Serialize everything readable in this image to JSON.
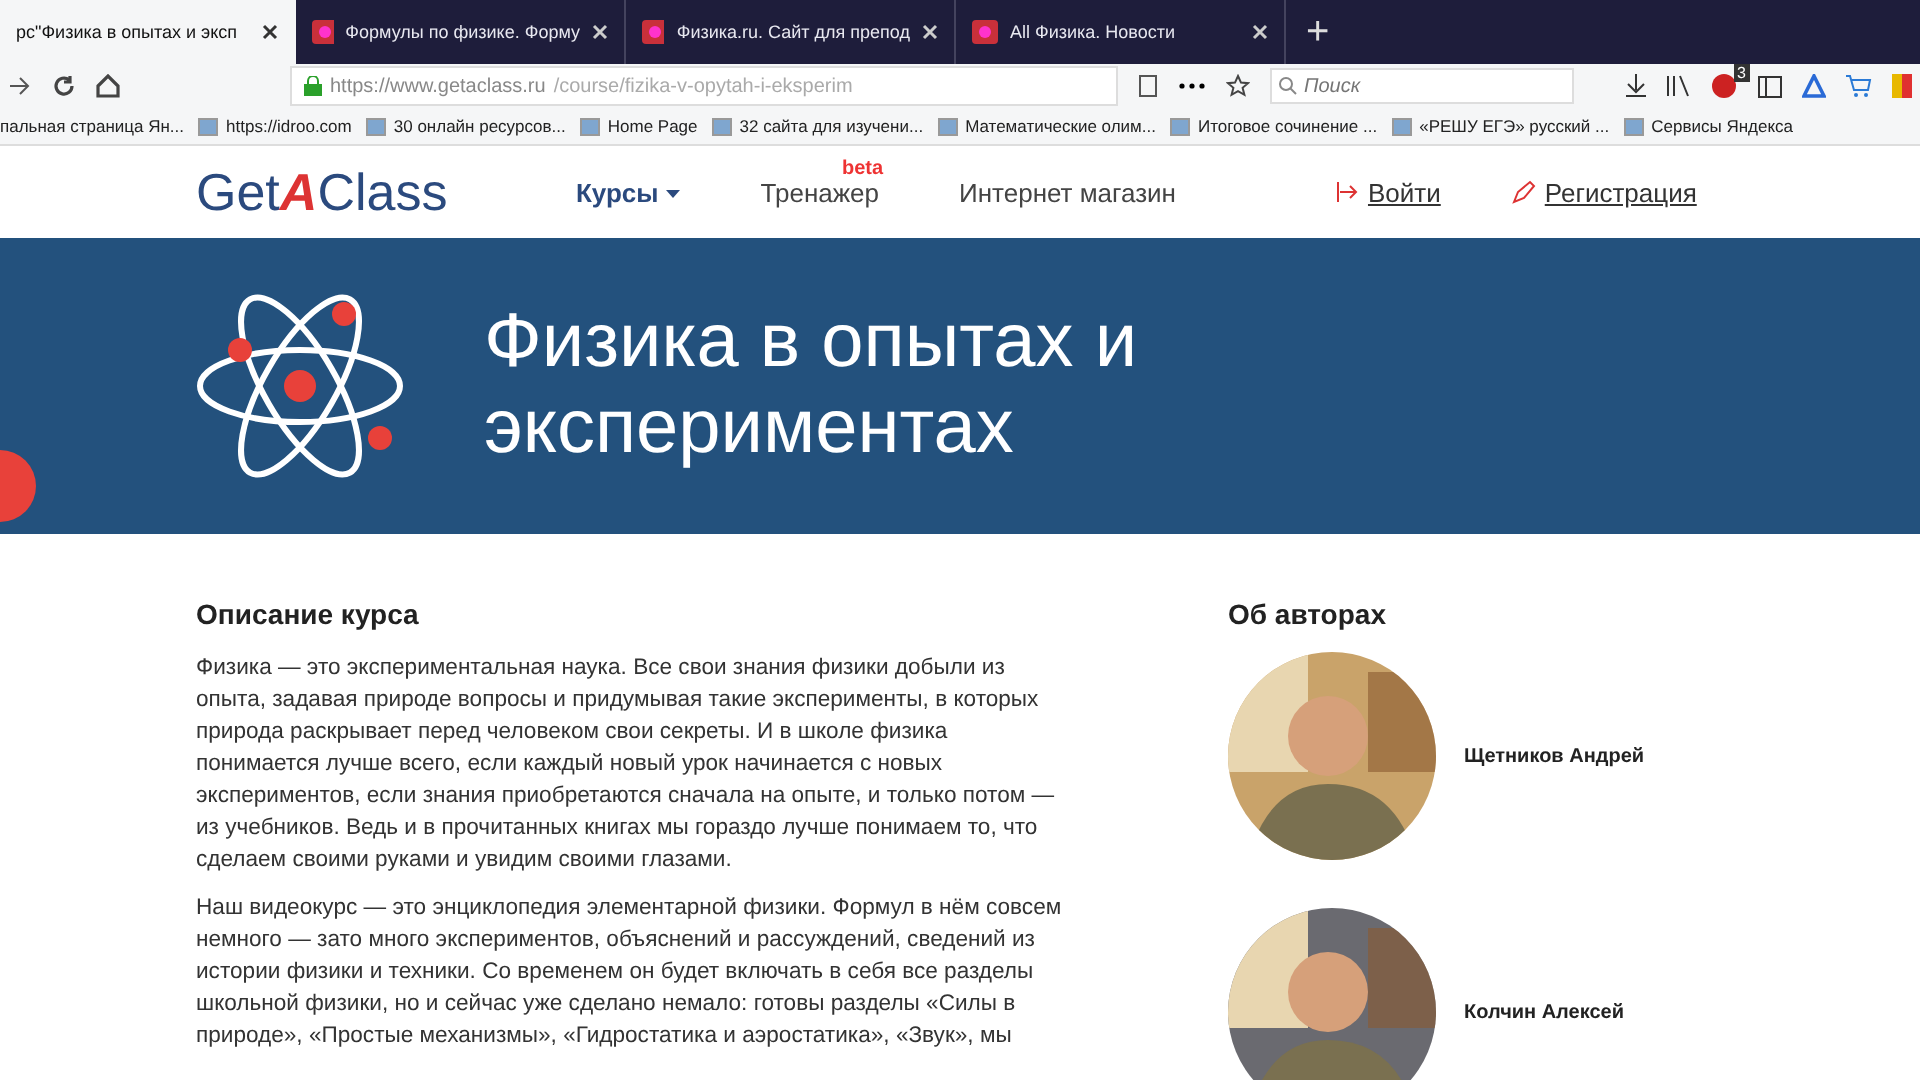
{
  "tabs": [
    {
      "title": "рс\"Физика в опытах и эксп",
      "selected": true
    },
    {
      "title": "Формулы по физике. Форму",
      "selected": false
    },
    {
      "title": "Физика.ru. Сайт для препод",
      "selected": false
    },
    {
      "title": "All Физика. Новости",
      "selected": false
    }
  ],
  "new_tab": "+",
  "address": {
    "url_host": "https://www.getaclass.ru",
    "url_path": "/course/fizika-v-opytah-i-eksperim"
  },
  "search": {
    "placeholder": "Поиск"
  },
  "badge": "3",
  "bookmarks": [
    {
      "label": "пальная страница Ян..."
    },
    {
      "label": "https://idroo.com"
    },
    {
      "label": "30 онлайн ресурсов..."
    },
    {
      "label": "Home Page"
    },
    {
      "label": "32 сайта для изучени..."
    },
    {
      "label": "Математические олим..."
    },
    {
      "label": "Итоговое сочинение ..."
    },
    {
      "label": "«РЕШУ ЕГЭ» русский ..."
    },
    {
      "label": "Сервисы Яндекса"
    }
  ],
  "site": {
    "logo_before": "Get",
    "logo_mark": "A",
    "logo_after": "Class",
    "nav": [
      {
        "label": "Курсы",
        "kind": "dropdown"
      },
      {
        "label": "Тренажер",
        "kind": "beta",
        "tag": "beta"
      },
      {
        "label": "Интернет магазин",
        "kind": "plain"
      }
    ],
    "login": "Войти",
    "register": "Регистрация"
  },
  "banner": {
    "title": "Физика в опытах и экспериментах"
  },
  "description": {
    "heading": "Описание курса",
    "paragraphs": [
      "Физика — это экспериментальная наука. Все свои знания физики добыли из опыта, задавая природе вопросы и придумывая такие эксперименты, в которых природа раскрывает перед человеком свои секреты. И в школе физика понимается лучше всего, если каждый новый урок начинается с новых экспериментов, если знания приобретаются сначала на опыте, и только потом — из учебников. Ведь и в прочитанных книгах мы гораздо лучше понимаем то, что сделаем своими руками и увидим своими глазами.",
      "Наш видеокурс — это энциклопедия элементарной физики. Формул в нём совсем немного — зато много экспериментов, объяснений и рассуждений, сведений из истории физики и техники. Со временем он будет включать в себя все разделы школьной физики, но и сейчас уже сделано немало: готовы разделы «Силы в природе», «Простые механизмы», «Гидростатика и аэростатика», «Звук», мы"
    ]
  },
  "authors": {
    "heading": "Об авторах",
    "items": [
      {
        "name": "Щетников Андрей",
        "color": "#c9a36a"
      },
      {
        "name": "Колчин Алексей",
        "color": "#6a6a70"
      }
    ]
  }
}
